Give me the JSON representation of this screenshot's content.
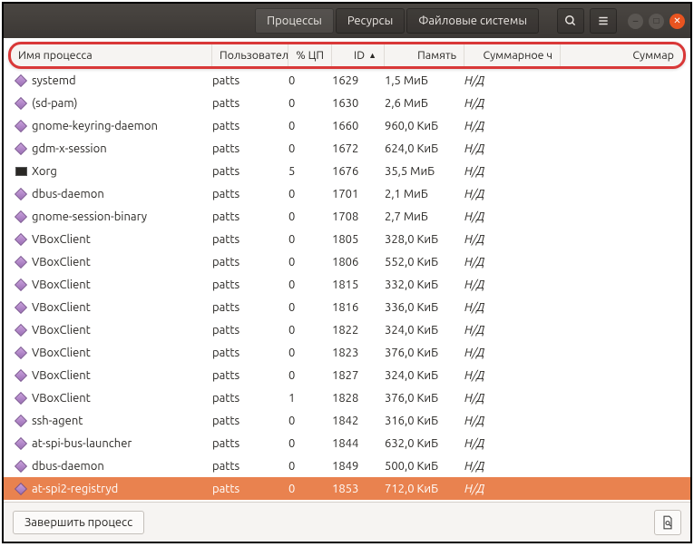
{
  "tabs": {
    "processes": "Процессы",
    "resources": "Ресурсы",
    "filesystems": "Файловые системы"
  },
  "columns": {
    "name": "Имя процесса",
    "user": "Пользовател",
    "cpu": "% ЦП",
    "id": "ID",
    "mem": "Память",
    "sum1": "Суммарное ч",
    "sum2": "Суммар"
  },
  "sort": {
    "column": "id",
    "direction": "asc"
  },
  "rows": [
    {
      "icon": "diamond",
      "name": "systemd",
      "user": "patts",
      "cpu": 0,
      "id": 1629,
      "mem": "1,5 МиБ",
      "sum1": "Н/Д",
      "selected": false
    },
    {
      "icon": "diamond",
      "name": "(sd-pam)",
      "user": "patts",
      "cpu": 0,
      "id": 1630,
      "mem": "2,6 МиБ",
      "sum1": "Н/Д",
      "selected": false
    },
    {
      "icon": "diamond",
      "name": "gnome-keyring-daemon",
      "user": "patts",
      "cpu": 0,
      "id": 1660,
      "mem": "960,0 КиБ",
      "sum1": "Н/Д",
      "selected": false
    },
    {
      "icon": "diamond",
      "name": "gdm-x-session",
      "user": "patts",
      "cpu": 0,
      "id": 1672,
      "mem": "624,0 КиБ",
      "sum1": "Н/Д",
      "selected": false
    },
    {
      "icon": "monitor",
      "name": "Xorg",
      "user": "patts",
      "cpu": 5,
      "id": 1676,
      "mem": "35,5 МиБ",
      "sum1": "Н/Д",
      "selected": false
    },
    {
      "icon": "diamond",
      "name": "dbus-daemon",
      "user": "patts",
      "cpu": 0,
      "id": 1701,
      "mem": "2,1 МиБ",
      "sum1": "Н/Д",
      "selected": false
    },
    {
      "icon": "diamond",
      "name": "gnome-session-binary",
      "user": "patts",
      "cpu": 0,
      "id": 1708,
      "mem": "2,7 МиБ",
      "sum1": "Н/Д",
      "selected": false
    },
    {
      "icon": "diamond",
      "name": "VBoxClient",
      "user": "patts",
      "cpu": 0,
      "id": 1805,
      "mem": "328,0 КиБ",
      "sum1": "Н/Д",
      "selected": false
    },
    {
      "icon": "diamond",
      "name": "VBoxClient",
      "user": "patts",
      "cpu": 0,
      "id": 1806,
      "mem": "552,0 КиБ",
      "sum1": "Н/Д",
      "selected": false
    },
    {
      "icon": "diamond",
      "name": "VBoxClient",
      "user": "patts",
      "cpu": 0,
      "id": 1815,
      "mem": "332,0 КиБ",
      "sum1": "Н/Д",
      "selected": false
    },
    {
      "icon": "diamond",
      "name": "VBoxClient",
      "user": "patts",
      "cpu": 0,
      "id": 1816,
      "mem": "336,0 КиБ",
      "sum1": "Н/Д",
      "selected": false
    },
    {
      "icon": "diamond",
      "name": "VBoxClient",
      "user": "patts",
      "cpu": 0,
      "id": 1822,
      "mem": "324,0 КиБ",
      "sum1": "Н/Д",
      "selected": false
    },
    {
      "icon": "diamond",
      "name": "VBoxClient",
      "user": "patts",
      "cpu": 0,
      "id": 1823,
      "mem": "376,0 КиБ",
      "sum1": "Н/Д",
      "selected": false
    },
    {
      "icon": "diamond",
      "name": "VBoxClient",
      "user": "patts",
      "cpu": 0,
      "id": 1827,
      "mem": "324,0 КиБ",
      "sum1": "Н/Д",
      "selected": false
    },
    {
      "icon": "diamond",
      "name": "VBoxClient",
      "user": "patts",
      "cpu": 1,
      "id": 1828,
      "mem": "376,0 КиБ",
      "sum1": "Н/Д",
      "selected": false
    },
    {
      "icon": "diamond",
      "name": "ssh-agent",
      "user": "patts",
      "cpu": 0,
      "id": 1842,
      "mem": "316,0 КиБ",
      "sum1": "Н/Д",
      "selected": false
    },
    {
      "icon": "diamond",
      "name": "at-spi-bus-launcher",
      "user": "patts",
      "cpu": 0,
      "id": 1844,
      "mem": "632,0 КиБ",
      "sum1": "Н/Д",
      "selected": false
    },
    {
      "icon": "diamond",
      "name": "dbus-daemon",
      "user": "patts",
      "cpu": 0,
      "id": 1849,
      "mem": "500,0 КиБ",
      "sum1": "Н/Д",
      "selected": false
    },
    {
      "icon": "diamond",
      "name": "at-spi2-registryd",
      "user": "patts",
      "cpu": 0,
      "id": 1853,
      "mem": "712,0 КиБ",
      "sum1": "Н/Д",
      "selected": true
    }
  ],
  "footer": {
    "end_process": "Завершить процесс"
  }
}
